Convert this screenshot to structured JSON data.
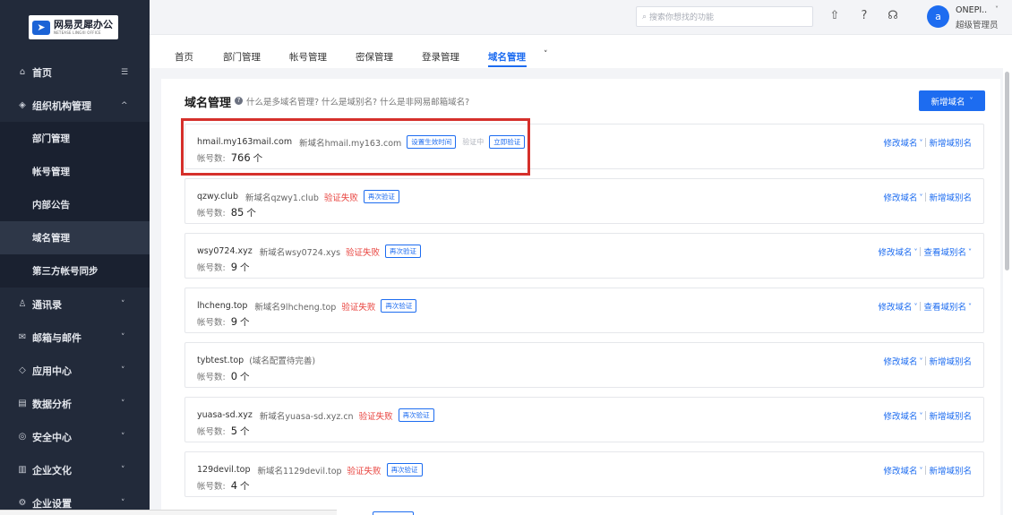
{
  "brand": {
    "name": "网易灵犀办公",
    "sub": "NETEASE LINGXI OFFICE"
  },
  "sidebar": {
    "items": [
      {
        "label": "首页",
        "icon": "home-icon",
        "glyph": "⌂",
        "trailing": "☰"
      },
      {
        "label": "组织机构管理",
        "icon": "org-icon",
        "glyph": "◈",
        "trailing": "^"
      },
      {
        "label": "通讯录",
        "icon": "contacts-icon",
        "glyph": "♙",
        "trailing": "˅"
      },
      {
        "label": "邮箱与邮件",
        "icon": "mail-icon",
        "glyph": "✉",
        "trailing": "˅"
      },
      {
        "label": "应用中心",
        "icon": "app-center-icon",
        "glyph": "◇",
        "trailing": "˅"
      },
      {
        "label": "数据分析",
        "icon": "analytics-icon",
        "glyph": "▤",
        "trailing": "˅"
      },
      {
        "label": "安全中心",
        "icon": "security-icon",
        "glyph": "◎",
        "trailing": "˅"
      },
      {
        "label": "企业文化",
        "icon": "culture-icon",
        "glyph": "▥",
        "trailing": "˅"
      },
      {
        "label": "企业设置",
        "icon": "settings-icon",
        "glyph": "⚙",
        "trailing": "˅"
      }
    ],
    "sub_items": [
      "部门管理",
      "帐号管理",
      "内部公告",
      "域名管理",
      "第三方帐号同步"
    ],
    "active_sub": "域名管理"
  },
  "topbar": {
    "search_placeholder": "搜索你想找的功能",
    "icons": [
      "upgrade-icon",
      "help-icon",
      "headset-icon"
    ],
    "avatar_letter": "a",
    "user_name": "ONEPI..",
    "user_role": "超级管理员"
  },
  "tabs": {
    "items": [
      "首页",
      "部门管理",
      "帐号管理",
      "密保管理",
      "登录管理",
      "域名管理"
    ],
    "active": "域名管理",
    "more": "˅"
  },
  "page": {
    "title": "域名管理",
    "help_text": "什么是多域名管理? 什么是域别名? 什么是非网易邮箱域名?",
    "add_button": "新增域名",
    "count_label": "帐号数:",
    "count_unit": "个",
    "edit_domain": "修改域名",
    "add_alias": "新增域别名",
    "view_alias": "查看域别名"
  },
  "domains": [
    {
      "domain": "hmail.my163mail.com",
      "new_name": "新域名hmail.my163.com",
      "pill": "设置生效时间",
      "pending": "验证中",
      "verify_btn": "立即验证",
      "count": "766",
      "alias_action": "新增域别名",
      "alias_chev": ""
    },
    {
      "domain": "qzwy.club",
      "new_name": "新域名qzwy1.club",
      "status": "验证失败",
      "verify_btn": "再次验证",
      "count": "85",
      "alias_action": "新增域别名",
      "alias_chev": ""
    },
    {
      "domain": "wsy0724.xyz",
      "new_name": "新域名wsy0724.xys",
      "status": "验证失败",
      "verify_btn": "再次验证",
      "count": "9",
      "alias_action": "查看域别名",
      "alias_chev": "˅"
    },
    {
      "domain": "lhcheng.top",
      "new_name": "新域名9lhcheng.top",
      "status": "验证失败",
      "verify_btn": "再次验证",
      "count": "9",
      "alias_action": "查看域别名",
      "alias_chev": "˅"
    },
    {
      "domain": "tybtest.top",
      "note": "(域名配置待完善)",
      "count": "0",
      "alias_action": "新增域别名",
      "alias_chev": ""
    },
    {
      "domain": "yuasa-sd.xyz",
      "new_name": "新域名yuasa-sd.xyz.cn",
      "status": "验证失败",
      "verify_btn": "再次验证",
      "count": "5",
      "alias_action": "新增域别名",
      "alias_chev": ""
    },
    {
      "domain": "129devil.top",
      "new_name": "新域名1129devil.top",
      "status": "验证失败",
      "verify_btn": "再次验证",
      "count": "4",
      "alias_action": "新增域别名",
      "alias_chev": ""
    }
  ],
  "colors": {
    "accent": "#1d6cf0",
    "sidebar_bg": "#222a3a",
    "error": "#e8423d",
    "highlight": "#d5302b"
  }
}
